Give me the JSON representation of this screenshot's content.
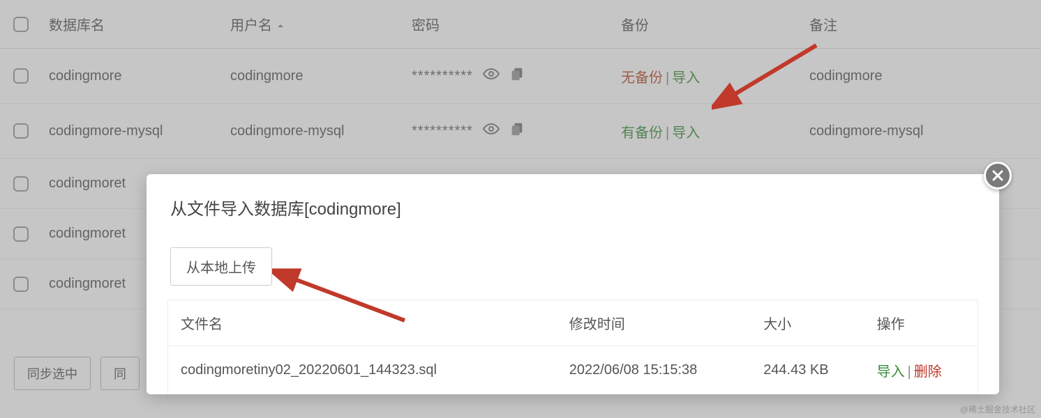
{
  "table": {
    "headers": {
      "db_name": "数据库名",
      "username": "用户名",
      "password": "密码",
      "backup": "备份",
      "note": "备注"
    },
    "rows": [
      {
        "db": "codingmore",
        "user": "codingmore",
        "pw": "**********",
        "backup_status": "no",
        "backup_text": "无备份",
        "import": "导入",
        "note": "codingmore"
      },
      {
        "db": "codingmore-mysql",
        "user": "codingmore-mysql",
        "pw": "**********",
        "backup_status": "yes",
        "backup_text": "有备份",
        "import": "导入",
        "note": "codingmore-mysql"
      },
      {
        "db": "codingmoret",
        "user": "",
        "pw": "",
        "backup_status": "",
        "backup_text": "",
        "import": "",
        "note": ""
      },
      {
        "db": "codingmoret",
        "user": "",
        "pw": "",
        "backup_status": "",
        "backup_text": "",
        "import": "",
        "note": ""
      },
      {
        "db": "codingmoret",
        "user": "",
        "pw": "",
        "backup_status": "",
        "backup_text": "",
        "import": "",
        "note": ""
      }
    ]
  },
  "footer": {
    "sync_selected": "同步选中",
    "other": "同"
  },
  "modal": {
    "title": "从文件导入数据库[codingmore]",
    "upload_label": "从本地上传",
    "headers": {
      "filename": "文件名",
      "mtime": "修改时间",
      "size": "大小",
      "action": "操作"
    },
    "file": {
      "name": "codingmoretiny02_20220601_144323.sql",
      "mtime": "2022/06/08 15:15:38",
      "size": "244.43 KB",
      "import": "导入",
      "delete": "删除"
    }
  },
  "watermark": "@稀土掘金技术社区"
}
